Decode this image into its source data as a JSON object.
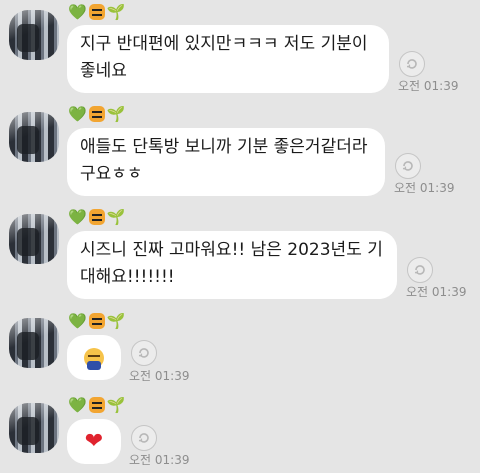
{
  "messages": [
    {
      "badges": [
        "green-heart",
        "tiger-face",
        "seedling"
      ],
      "text": "지구 반대편에 있지만ㅋㅋㅋ 저도 기분이\n좋네요",
      "time": "오전 01:39"
    },
    {
      "badges": [
        "green-heart",
        "tiger-face",
        "seedling"
      ],
      "text": "애들도 단톡방 보니까 기분 좋은거같더라\n구요ㅎㅎ",
      "time": "오전 01:39"
    },
    {
      "badges": [
        "green-heart",
        "tiger-face",
        "seedling"
      ],
      "text": "시즈니 진짜 고마워요!! 남은 2023년도 기\n대해요!!!!!!!",
      "time": "오전 01:39"
    },
    {
      "badges": [
        "green-heart",
        "tiger-face",
        "seedling"
      ],
      "text": "",
      "emoji": "bowing-face",
      "time": "오전 01:39"
    },
    {
      "badges": [
        "green-heart",
        "tiger-face",
        "seedling"
      ],
      "text": "",
      "emoji": "red-heart",
      "time": "오전 01:39"
    }
  ],
  "glyphs": {
    "green_heart": "💚",
    "seedling": "🌱",
    "red_heart": "❤"
  }
}
